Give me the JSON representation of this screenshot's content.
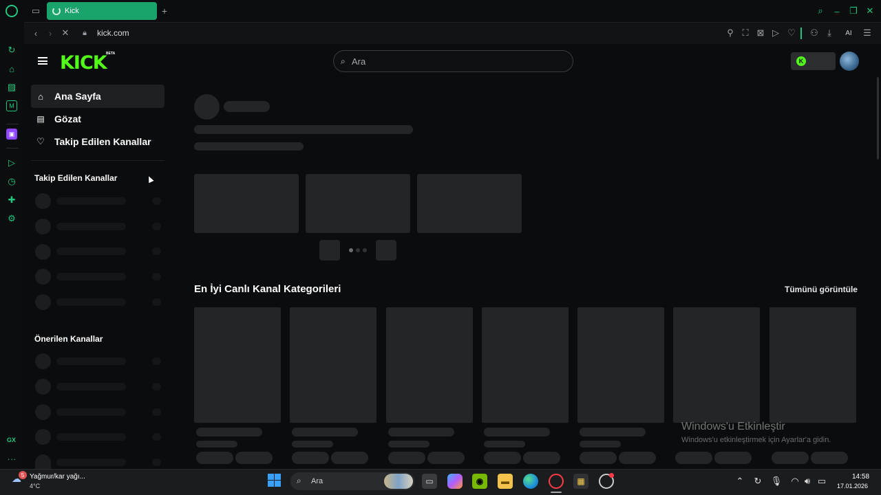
{
  "browser": {
    "tab_title": "Kick",
    "address": "kick.com",
    "ai_label": "AI"
  },
  "opera_sidebar": {
    "bottom_label": "GX",
    "more_label": "..."
  },
  "header": {
    "logo_text": "KICK",
    "logo_badge": "BETA",
    "search_placeholder": "Ara"
  },
  "sidebar": {
    "nav": [
      {
        "label": "Ana Sayfa",
        "icon": "home-icon"
      },
      {
        "label": "Gözat",
        "icon": "browse-icon"
      },
      {
        "label": "Takip Edilen Kanallar",
        "icon": "heart-icon"
      }
    ],
    "following_title": "Takip Edilen Kanallar",
    "recommended_title": "Önerilen Kanallar"
  },
  "main": {
    "categories_title": "En İyi Canlı Kanal Kategorileri",
    "view_all": "Tümünü görüntüle"
  },
  "watermark": {
    "title": "Windows'u Etkinleştir",
    "subtitle": "Windows'u etkinleştirmek için Ayarlar'a gidin."
  },
  "taskbar": {
    "weather_title": "Yağmur/kar yağı...",
    "weather_temp": "4°C",
    "weather_badge": "5",
    "search_label": "Ara",
    "time": "14:58",
    "date": "17.01.2026"
  },
  "colors": {
    "accent": "#53fc18",
    "opera_green": "#1aa36b",
    "background": "#0b0c0d"
  }
}
